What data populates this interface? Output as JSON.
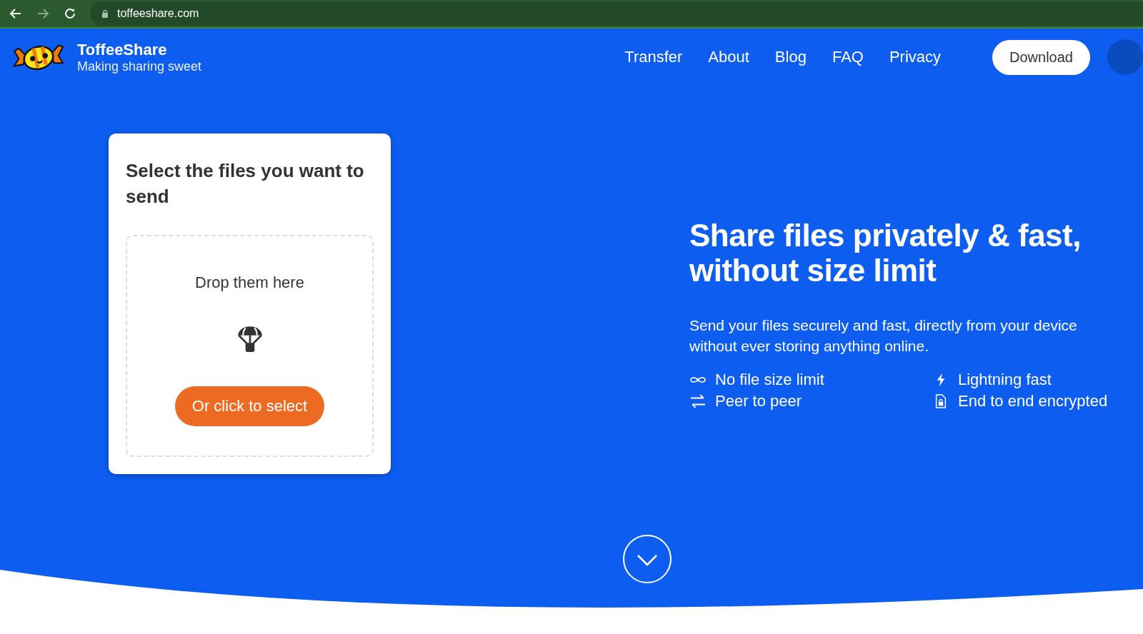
{
  "browser": {
    "url": "toffeeshare.com"
  },
  "brand": {
    "name": "ToffeeShare",
    "tagline": "Making sharing sweet"
  },
  "nav": [
    {
      "label": "Transfer"
    },
    {
      "label": "About"
    },
    {
      "label": "Blog"
    },
    {
      "label": "FAQ"
    },
    {
      "label": "Privacy"
    }
  ],
  "download_button": "Download",
  "upload_card": {
    "title": "Select the files you want to send",
    "drop_text": "Drop them here",
    "select_button": "Or click to select"
  },
  "hero": {
    "headline": "Share files privately & fast, without size limit",
    "description": "Send your files securely and fast, directly from your device without ever storing anything online.",
    "features": [
      {
        "label": "No file size limit"
      },
      {
        "label": "Lightning fast"
      },
      {
        "label": "Peer to peer"
      },
      {
        "label": "End to end encrypted"
      }
    ]
  }
}
